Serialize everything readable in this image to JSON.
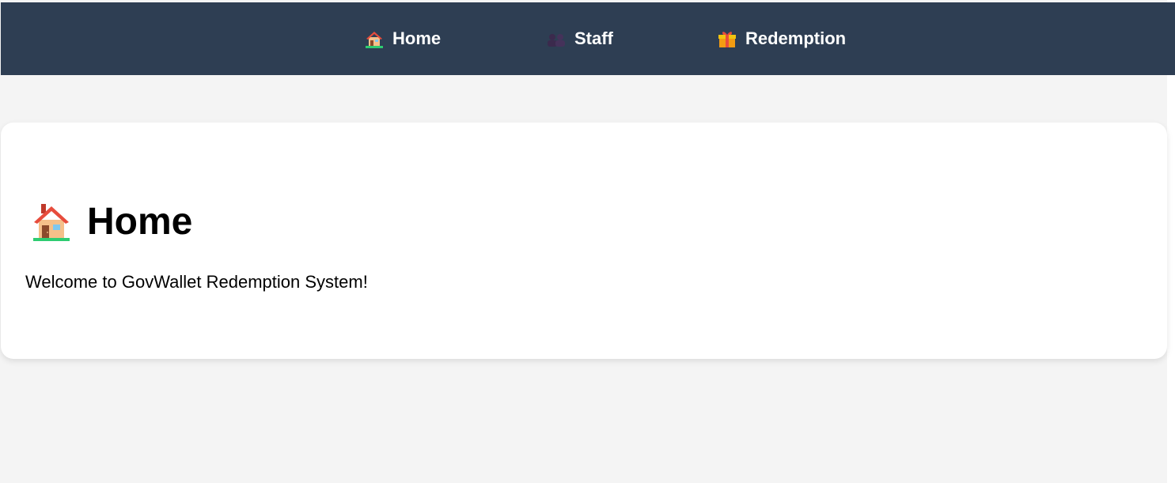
{
  "nav": {
    "items": [
      {
        "label": "Home",
        "icon": "house-icon"
      },
      {
        "label": "Staff",
        "icon": "people-icon"
      },
      {
        "label": "Redemption",
        "icon": "gift-icon"
      }
    ]
  },
  "main": {
    "title": "Home",
    "title_icon": "house-icon",
    "welcome": "Welcome to GovWallet Redemption System!"
  },
  "colors": {
    "navbar_bg": "#2e3e53",
    "page_bg": "#f4f4f4",
    "card_bg": "#ffffff"
  }
}
